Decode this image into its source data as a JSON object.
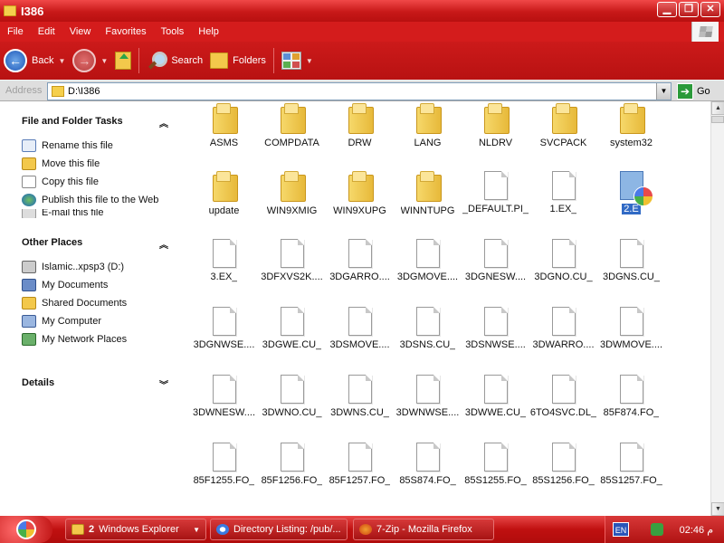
{
  "window": {
    "title": "I386",
    "controls": {
      "minimize": "▁",
      "restore": "❐",
      "close": "✕"
    }
  },
  "menu": [
    "File",
    "Edit",
    "View",
    "Favorites",
    "Tools",
    "Help"
  ],
  "toolbar": {
    "back": "Back",
    "search": "Search",
    "folders": "Folders"
  },
  "address": {
    "label": "Address",
    "value": "D:\\I386",
    "go": "Go"
  },
  "tasks_panel": {
    "title": "File and Folder Tasks",
    "items": [
      "Rename this file",
      "Move this file",
      "Copy this file",
      "Publish this file to the Web",
      "E-mail this file"
    ]
  },
  "places_panel": {
    "title": "Other Places",
    "items": [
      "Islamic..xpsp3 (D:)",
      "My Documents",
      "Shared Documents",
      "My Computer",
      "My Network Places"
    ]
  },
  "details_panel": {
    "title": "Details"
  },
  "files": [
    {
      "name": "ASMS",
      "kind": "folder"
    },
    {
      "name": "COMPDATA",
      "kind": "folder"
    },
    {
      "name": "DRW",
      "kind": "folder"
    },
    {
      "name": "LANG",
      "kind": "folder"
    },
    {
      "name": "NLDRV",
      "kind": "folder"
    },
    {
      "name": "SVCPACK",
      "kind": "folder"
    },
    {
      "name": "system32",
      "kind": "folder"
    },
    {
      "name": "update",
      "kind": "folder"
    },
    {
      "name": "WIN9XMIG",
      "kind": "folder"
    },
    {
      "name": "WIN9XUPG",
      "kind": "folder"
    },
    {
      "name": "WINNTUPG",
      "kind": "folder"
    },
    {
      "name": "_DEFAULT.PI_",
      "kind": "file"
    },
    {
      "name": "1.EX_",
      "kind": "file"
    },
    {
      "name": "2.E",
      "kind": "selected"
    },
    {
      "name": "3.EX_",
      "kind": "file"
    },
    {
      "name": "3DFXVS2K....",
      "kind": "file"
    },
    {
      "name": "3DGARRO....",
      "kind": "file"
    },
    {
      "name": "3DGMOVE....",
      "kind": "file"
    },
    {
      "name": "3DGNESW....",
      "kind": "file"
    },
    {
      "name": "3DGNO.CU_",
      "kind": "file"
    },
    {
      "name": "3DGNS.CU_",
      "kind": "file"
    },
    {
      "name": "3DGNWSE....",
      "kind": "file"
    },
    {
      "name": "3DGWE.CU_",
      "kind": "file"
    },
    {
      "name": "3DSMOVE....",
      "kind": "file"
    },
    {
      "name": "3DSNS.CU_",
      "kind": "file"
    },
    {
      "name": "3DSNWSE....",
      "kind": "file"
    },
    {
      "name": "3DWARRO....",
      "kind": "file"
    },
    {
      "name": "3DWMOVE....",
      "kind": "file"
    },
    {
      "name": "3DWNESW....",
      "kind": "file"
    },
    {
      "name": "3DWNO.CU_",
      "kind": "file"
    },
    {
      "name": "3DWNS.CU_",
      "kind": "file"
    },
    {
      "name": "3DWNWSE....",
      "kind": "file"
    },
    {
      "name": "3DWWE.CU_",
      "kind": "file"
    },
    {
      "name": "6TO4SVC.DL_",
      "kind": "file"
    },
    {
      "name": "85F874.FO_",
      "kind": "file"
    },
    {
      "name": "85F1255.FO_",
      "kind": "file"
    },
    {
      "name": "85F1256.FO_",
      "kind": "file"
    },
    {
      "name": "85F1257.FO_",
      "kind": "file"
    },
    {
      "name": "85S874.FO_",
      "kind": "file"
    },
    {
      "name": "85S1255.FO_",
      "kind": "file"
    },
    {
      "name": "85S1256.FO_",
      "kind": "file"
    },
    {
      "name": "85S1257.FO_",
      "kind": "file"
    }
  ],
  "taskbar": {
    "buttons": [
      {
        "count": "2",
        "label": "Windows Explorer",
        "icon": "explorer"
      },
      {
        "label": "Directory Listing: /pub/...",
        "icon": "ie"
      },
      {
        "label": "7-Zip - Mozilla Firefox",
        "icon": "ff"
      }
    ],
    "lang": "EN",
    "clock": "02:46 م"
  }
}
